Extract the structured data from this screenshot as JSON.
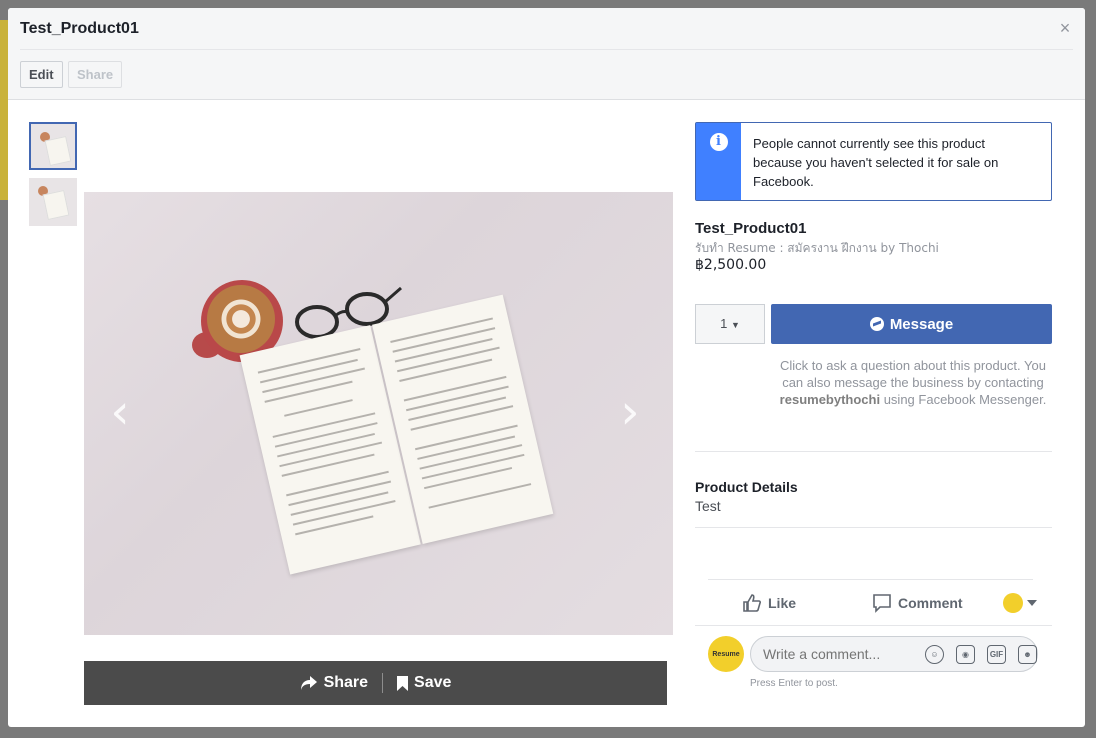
{
  "modal": {
    "title": "Test_Product01",
    "close": "×",
    "edit_label": "Edit",
    "share_label": "Share"
  },
  "photo_bar": {
    "share_label": "Share",
    "save_label": "Save"
  },
  "notice": {
    "text": "People cannot currently see this product because you haven't selected it for sale on Facebook."
  },
  "product": {
    "name": "Test_Product01",
    "subtitle": "รับทำ Resume : สมัครงาน ฝึกงาน by Thochi",
    "price": "฿2,500.00"
  },
  "purchase": {
    "quantity": "1",
    "message_label": "Message",
    "help_prefix": "Click to ask a question about this product. You can also message the business by contacting ",
    "help_handle": "resumebythochi",
    "help_suffix": " using Facebook Messenger."
  },
  "details": {
    "label": "Product Details",
    "value": "Test"
  },
  "actions": {
    "like_label": "Like",
    "comment_label": "Comment"
  },
  "comment": {
    "placeholder": "Write a comment...",
    "hint": "Press Enter to post.",
    "avatar_text": "Resume",
    "icons": [
      "emoji-icon",
      "camera-icon",
      "gif-icon",
      "sticker-icon"
    ]
  },
  "colors": {
    "brand_blue": "#4267b2",
    "info_blue": "#4080ff",
    "photo_bar": "#4b4b4b"
  }
}
